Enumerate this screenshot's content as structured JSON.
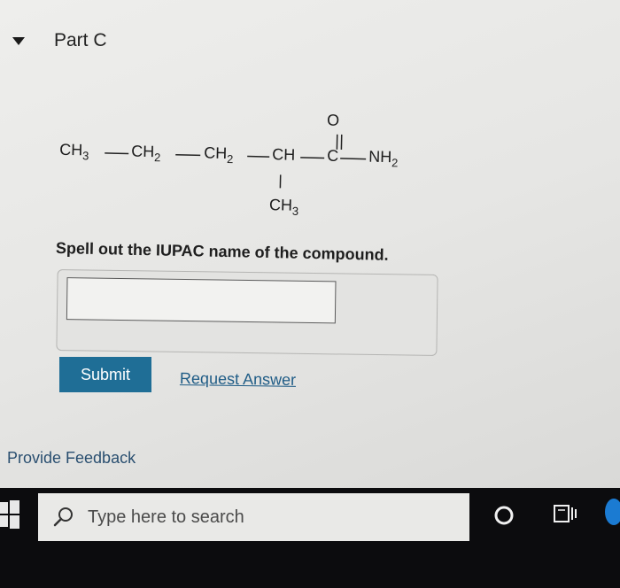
{
  "part": {
    "title": "Part C"
  },
  "compound": {
    "main_chain": [
      {
        "base": "CH",
        "sub": "3"
      },
      {
        "base": "CH",
        "sub": "2"
      },
      {
        "base": "CH",
        "sub": "2"
      },
      {
        "base": "CH",
        "sub": ""
      },
      {
        "base": "C",
        "sub": ""
      },
      {
        "base": "NH",
        "sub": "2"
      }
    ],
    "carbonyl_oxygen": "O",
    "branch": {
      "base": "CH",
      "sub": "3"
    }
  },
  "question": {
    "instruction": "Spell out the IUPAC name of the compound.",
    "answer_value": ""
  },
  "actions": {
    "submit_label": "Submit",
    "request_answer_label": "Request Answer"
  },
  "feedback": {
    "label": "Provide Feedback"
  },
  "taskbar": {
    "search_placeholder": "Type here to search",
    "icons": [
      "windows-start-icon",
      "search-icon",
      "cortana-icon",
      "task-view-icon",
      "app-icon"
    ]
  },
  "colors": {
    "submit_bg": "#1f6e96",
    "link": "#1f5c86",
    "taskbar_bg": "#0c0c0e"
  }
}
